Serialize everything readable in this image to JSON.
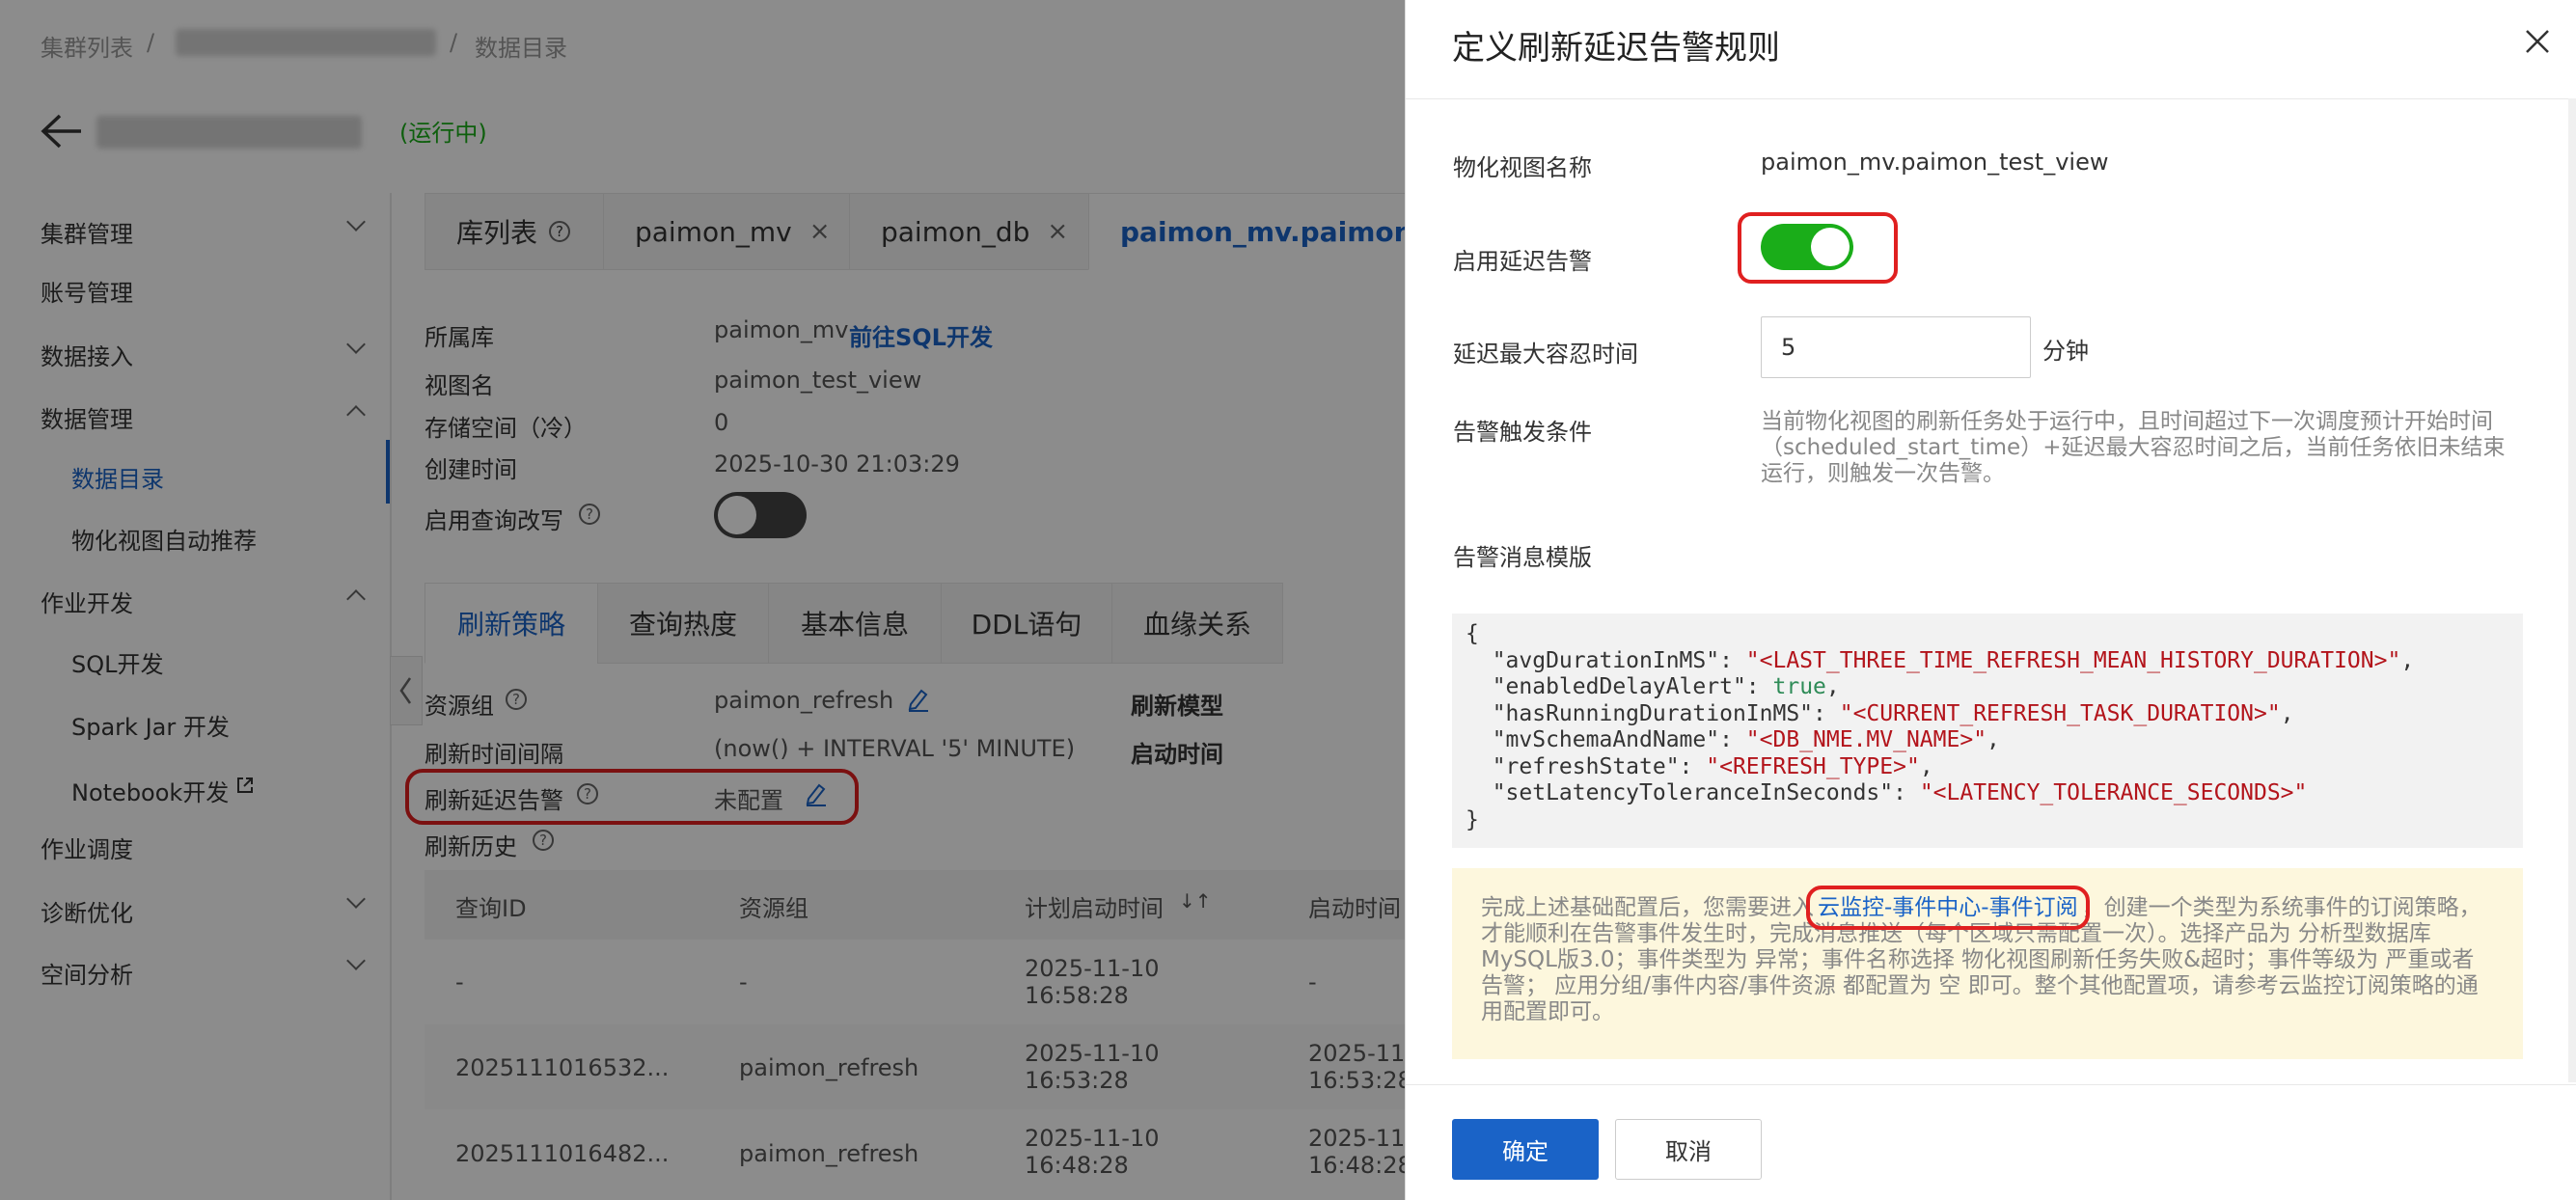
{
  "breadcrumb": {
    "item1": "集群列表",
    "sep": "/",
    "item3": "数据目录"
  },
  "cluster": {
    "status": "(运行中)"
  },
  "sidebar": {
    "items": [
      {
        "label": "集群管理"
      },
      {
        "label": "账号管理"
      },
      {
        "label": "数据接入"
      },
      {
        "label": "数据管理"
      },
      {
        "label": "数据目录"
      },
      {
        "label": "物化视图自动推荐"
      },
      {
        "label": "作业开发"
      },
      {
        "label": "SQL开发"
      },
      {
        "label": "Spark Jar 开发"
      },
      {
        "label": "Notebook开发"
      },
      {
        "label": "作业调度"
      },
      {
        "label": "诊断优化"
      },
      {
        "label": "空间分析"
      }
    ]
  },
  "tabs": [
    "库列表",
    "paimon_mv",
    "paimon_db",
    "paimon_mv.paimon_t"
  ],
  "info": {
    "db_label": "所属库",
    "db_value": "paimon_mv",
    "db_link": "前往SQL开发",
    "view_label": "视图名",
    "view_value": "paimon_test_view",
    "storage_label": "存储空间（冷）",
    "storage_value": "0",
    "created_label": "创建时间",
    "created_value": "2025-10-30 21:03:29",
    "rewrite_label": "启用查询改写"
  },
  "subtabs": [
    "刷新策略",
    "查询热度",
    "基本信息",
    "DDL语句",
    "血缘关系"
  ],
  "refresh": {
    "group_label": "资源组",
    "group_value": "paimon_refresh",
    "model_label": "刷新模型",
    "interval_label": "刷新时间间隔",
    "interval_value": "(now() + INTERVAL '5' MINUTE)",
    "start_label": "启动时间",
    "alert_label": "刷新延迟告警",
    "alert_value": "未配置",
    "history_label": "刷新历史"
  },
  "table": {
    "headers": [
      "查询ID",
      "资源组",
      "计划启动时间",
      "启动时间"
    ],
    "rows": [
      {
        "id": "-",
        "group": "-",
        "planned_date": "2025-11-10",
        "planned_time": "16:58:28",
        "start": "-"
      },
      {
        "id": "2025111016532...",
        "group": "paimon_refresh",
        "planned_date": "2025-11-10",
        "planned_time": "16:53:28",
        "start_date": "2025-11",
        "start_time": "16:53:28"
      },
      {
        "id": "2025111016482...",
        "group": "paimon_refresh",
        "planned_date": "2025-11-10",
        "planned_time": "16:48:28",
        "start_date": "2025-11",
        "start_time": "16:48:28"
      }
    ]
  },
  "drawer": {
    "title": "定义刷新延迟告警规则",
    "mv_name_label": "物化视图名称",
    "mv_name_value": "paimon_mv.paimon_test_view",
    "enable_label": "启用延迟告警",
    "enable_on": true,
    "tolerance_label": "延迟最大容忍时间",
    "tolerance_value": "5",
    "tolerance_unit": "分钟",
    "trigger_label": "告警触发条件",
    "trigger_line1": "当前物化视图的刷新任务处于运行中，且时间超过下一次调度预计开始时间",
    "trigger_line2": "（scheduled_start_time）+延迟最大容忍时间之后，当前任务依旧未结束",
    "trigger_line3": "运行，则触发一次告警。",
    "template_label": "告警消息模版",
    "code": {
      "open": "{",
      "k1": "  \"avgDurationInMS\": ",
      "v1": "\"<LAST_THREE_TIME_REFRESH_MEAN_HISTORY_DURATION>\"",
      "k2": "  \"enabledDelayAlert\": ",
      "v2": "true",
      "k3": "  \"hasRunningDurationInMS\": ",
      "v3": "\"<CURRENT_REFRESH_TASK_DURATION>\"",
      "k4": "  \"mvSchemaAndName\": ",
      "v4": "\"<DB_NME.MV_NAME>\"",
      "k5": "  \"refreshState\": ",
      "v5": "\"<REFRESH_TYPE>\"",
      "k6": "  \"setLatencyToleranceInSeconds\": ",
      "v6": "\"<LATENCY_TOLERANCE_SECONDS>\"",
      "close": "}"
    },
    "notice": {
      "pre": "完成上述基础配置后，您需要进入",
      "link": "云监控-事件中心-事件订阅",
      "post": "，创建一个类型为系统事件的订阅策略，才能顺利在告警事件发生时，完成消息推送（每个区域只需配置一次）。选择产品为 分析型数据库MySQL版3.0；事件类型为 异常；事件名称选择 物化视图刷新任务失败&超时；事件等级为 严重或者告警； 应用分组/事件内容/事件资源 都配置为 空 即可。整个其他配置项，请参考云监控订阅策略的通用配置即可。"
    },
    "ok": "确定",
    "cancel": "取消"
  },
  "colors": {
    "primary": "#1a63c7",
    "toggle_on": "#1aad19",
    "highlight": "#e02020",
    "notice_bg": "#fdf7dd"
  }
}
